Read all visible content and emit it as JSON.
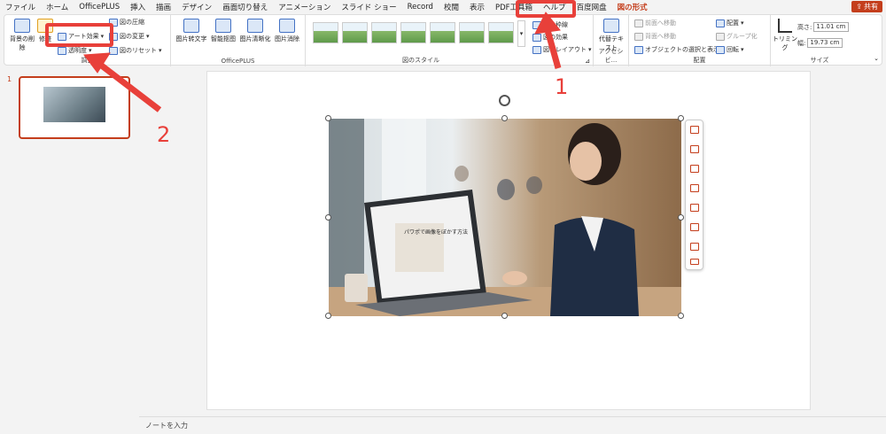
{
  "menu": {
    "tabs": [
      "ファイル",
      "ホーム",
      "OfficePLUS",
      "挿入",
      "描画",
      "デザイン",
      "画面切り替え",
      "アニメーション",
      "スライド ショー",
      "Record",
      "校閲",
      "表示",
      "PDF工具箱",
      "ヘルプ",
      "百度网盘",
      "図の形式"
    ],
    "share_label": "共有"
  },
  "ribbon": {
    "adjust": {
      "remove_bg": "背景の削除",
      "corrections": "修整",
      "art_effects": "アート効果",
      "transparency": "透明度",
      "compress": "図の圧縮",
      "change": "図の変更",
      "reset": "図のリセット",
      "label": "調整"
    },
    "officeplus": {
      "btn1": "图片转文字",
      "btn2": "智能抠图",
      "btn3": "图片清晰化",
      "btn4": "图片消除",
      "label": "OfficePLUS"
    },
    "styles": {
      "label": "図のスタイル",
      "border": "図の枠線",
      "effects": "図の効果",
      "layout": "図のレイアウト"
    },
    "accessibility": {
      "alt_text": "代替テキスト",
      "label": "アクセシビ..."
    },
    "arrange": {
      "bring_forward": "前面へ移動",
      "send_backward": "背面へ移動",
      "selection_pane": "オブジェクトの選択と表示",
      "align": "配置",
      "group": "グループ化",
      "rotate": "回転",
      "label": "配置"
    },
    "size": {
      "crop": "トリミング",
      "height_label": "高さ:",
      "height_value": "11.01 cm",
      "width_label": "幅:",
      "width_value": "19.73 cm",
      "label": "サイズ"
    }
  },
  "slides": {
    "current_number": "1"
  },
  "slide_content": {
    "laptop_title": "パワポで画像をぼかす方法"
  },
  "notes": {
    "placeholder": "ノートを入力"
  },
  "annotations": {
    "marker1": "1",
    "marker2": "2",
    "color": "#e8403a"
  },
  "colors": {
    "accent": "#c43e1c"
  }
}
